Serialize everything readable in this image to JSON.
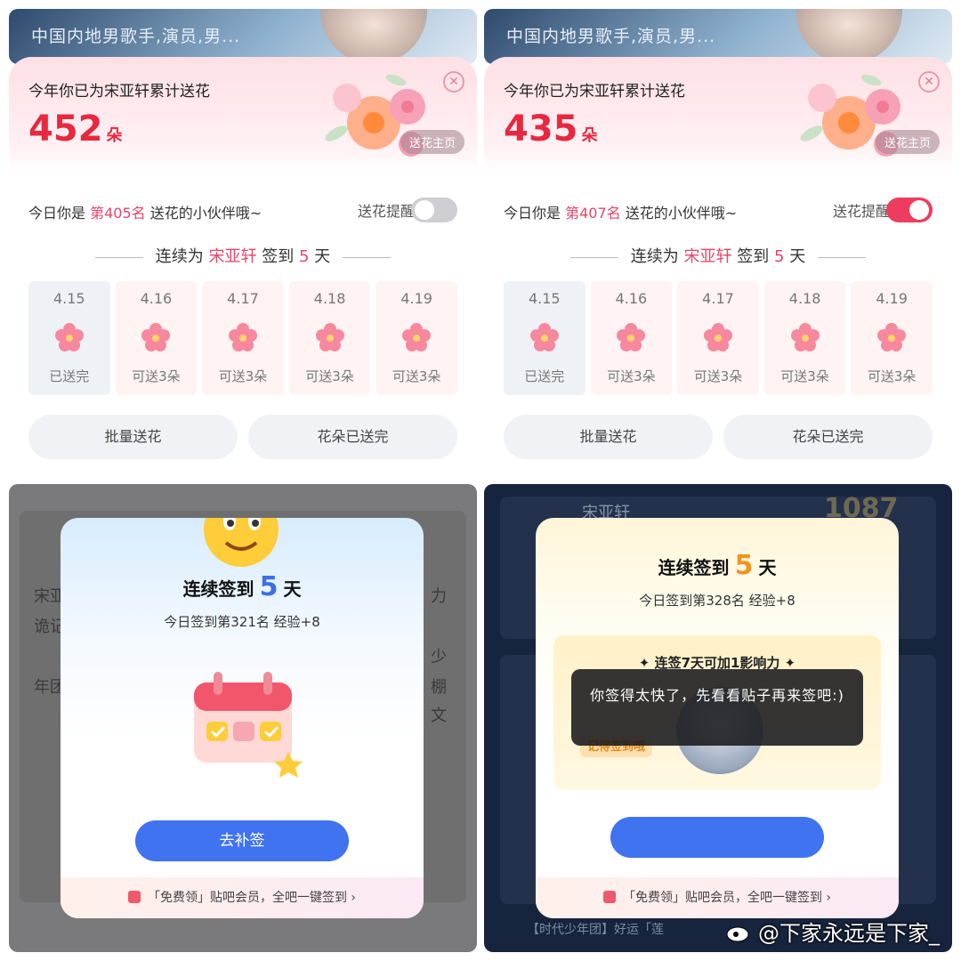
{
  "flower_panels": [
    {
      "celebrity_desc": "中国内地男歌手,演员,男...",
      "title": "今年你已为宋亚轩累计送花",
      "count": "452",
      "unit": "朵",
      "home_label": "送花主页",
      "rank_prefix": "今日你是",
      "rank": "第405名",
      "rank_suffix": "送花的小伙伴哦~",
      "remind_label": "送花提醒",
      "remind_on": false,
      "streak_prefix": "连续为",
      "streak_name": "宋亚轩",
      "streak_mid": "签到",
      "streak_days": "5",
      "streak_suffix": "天",
      "days": [
        {
          "date": "4.15",
          "status": "已送完"
        },
        {
          "date": "4.16",
          "status": "可送3朵"
        },
        {
          "date": "4.17",
          "status": "可送3朵"
        },
        {
          "date": "4.18",
          "status": "可送3朵"
        },
        {
          "date": "4.19",
          "status": "可送3朵"
        }
      ],
      "batch_label": "批量送花",
      "done_label": "花朵已送完"
    },
    {
      "celebrity_desc": "中国内地男歌手,演员,男...",
      "title": "今年你已为宋亚轩累计送花",
      "count": "435",
      "unit": "朵",
      "home_label": "送花主页",
      "rank_prefix": "今日你是",
      "rank": "第407名",
      "rank_suffix": "送花的小伙伴哦~",
      "remind_label": "送花提醒",
      "remind_on": true,
      "streak_prefix": "连续为",
      "streak_name": "宋亚轩",
      "streak_mid": "签到",
      "streak_days": "5",
      "streak_suffix": "天",
      "days": [
        {
          "date": "4.15",
          "status": "已送完"
        },
        {
          "date": "4.16",
          "status": "可送3朵"
        },
        {
          "date": "4.17",
          "status": "可送3朵"
        },
        {
          "date": "4.18",
          "status": "可送3朵"
        },
        {
          "date": "4.19",
          "status": "可送3朵"
        }
      ],
      "batch_label": "批量送花",
      "done_label": "花朵已送完"
    }
  ],
  "signin_left": {
    "title_prefix": "连续签到",
    "days": "5",
    "title_suffix": "天",
    "sub": "今日签到第321名 经验+8",
    "button": "去补签",
    "footer": "「免费领」贴吧会员，全吧一键签到 ›",
    "bg_texts": [
      "宋亚",
      "诡记",
      "年团",
      "力",
      "少",
      "棚",
      "文"
    ]
  },
  "signin_right": {
    "title_prefix": "连续签到",
    "days": "5",
    "title_suffix": "天",
    "sub": "今日签到第328名 经验+8",
    "box_heading": "连签7天可加1影响力",
    "box_tag": "记得签到哦",
    "toast": "你签得太快了，先看看贴子再来签吧:)",
    "footer": "「免费领」贴吧会员，全吧一键签到 ›",
    "bg_score": "1087",
    "bg_name": "宋亚轩",
    "bg_bottom": "【时代少年团】好运「莲"
  },
  "watermark": "@下家永远是下家_",
  "colors": {
    "accent_red": "#e8283f",
    "accent_pink": "#e8456a",
    "toggle_on": "#ee3c5e",
    "primary_blue": "#3f73f0",
    "streak_orange": "#f0941d"
  }
}
